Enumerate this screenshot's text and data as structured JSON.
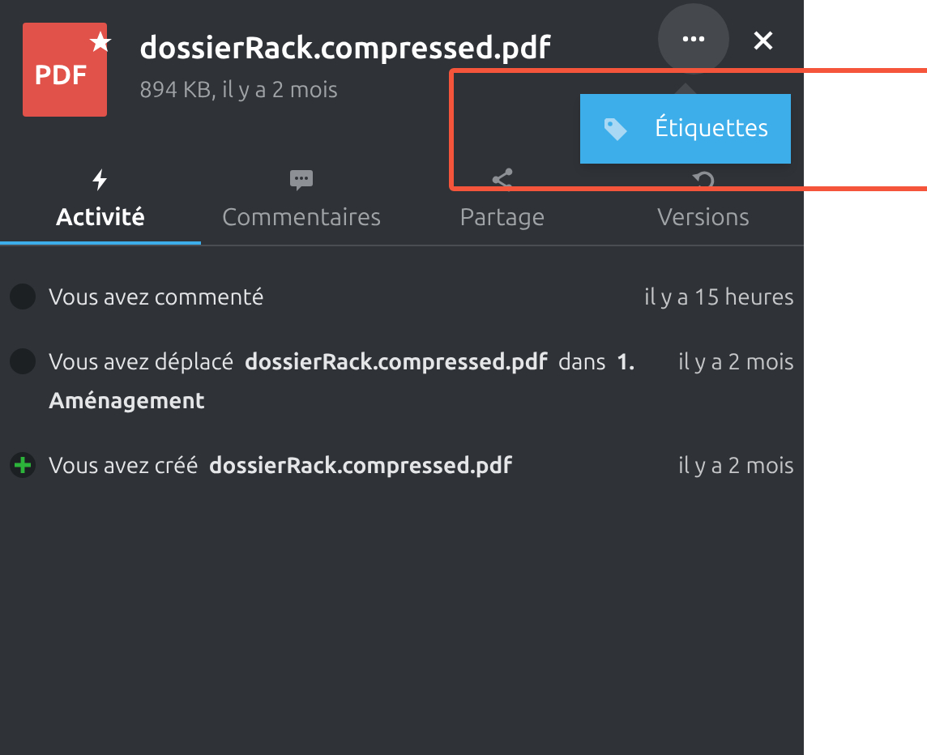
{
  "file": {
    "icon_label": "PDF",
    "favorite": true,
    "name": "dossierRack.compressed.pdf",
    "info": "894 KB, il y a 2 mois"
  },
  "menu": {
    "items": [
      {
        "label": "Étiquettes"
      }
    ]
  },
  "tabs": [
    {
      "label": "Activité",
      "kind": "bolt",
      "selected": true
    },
    {
      "label": "Commentaires",
      "kind": "comment",
      "selected": false
    },
    {
      "label": "Partage",
      "kind": "share",
      "selected": false
    },
    {
      "label": "Versions",
      "kind": "history",
      "selected": false
    }
  ],
  "activities": [
    {
      "kind": "comment",
      "text": "Vous avez commenté",
      "time": "il y a 15 heures"
    },
    {
      "kind": "move",
      "text": "Vous avez déplacé  **dossierRack.compressed.pdf**  dans  **1. Aménagement**",
      "time": "il y a 2 mois"
    },
    {
      "kind": "create",
      "text": "Vous avez créé  **dossierRack.compressed.pdf**",
      "time": "il y a 2 mois"
    }
  ]
}
